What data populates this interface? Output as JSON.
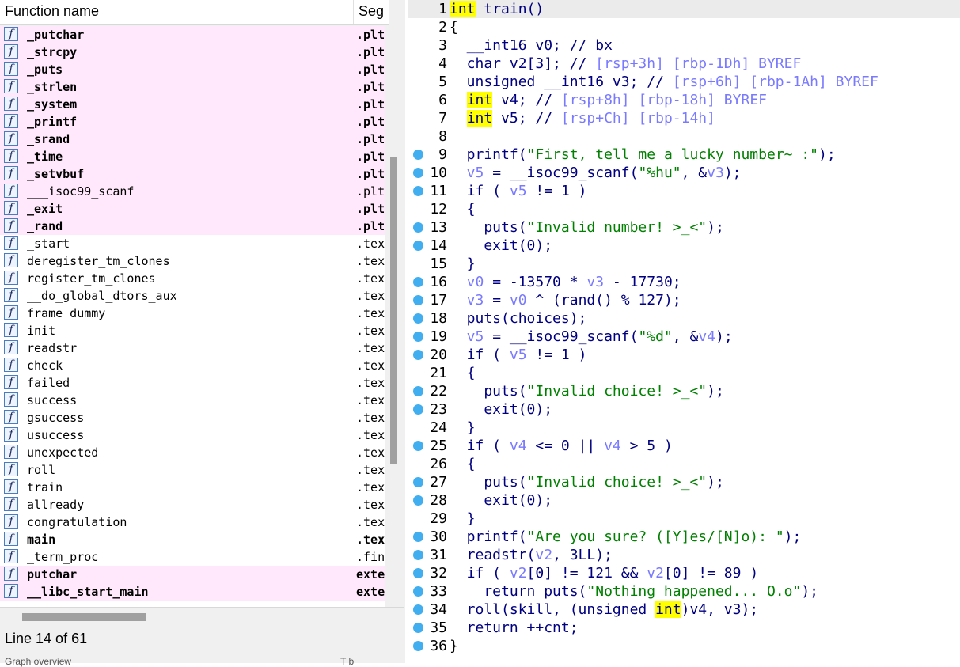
{
  "function_list": {
    "header": {
      "name_col": "Function name",
      "seg_col": "Seg"
    },
    "icon_glyph": "f",
    "rows": [
      {
        "name": "_putchar",
        "seg": ".plt",
        "bold": true,
        "pink": true
      },
      {
        "name": "_strcpy",
        "seg": ".plt",
        "bold": true,
        "pink": true
      },
      {
        "name": "_puts",
        "seg": ".plt",
        "bold": true,
        "pink": true
      },
      {
        "name": "_strlen",
        "seg": ".plt",
        "bold": true,
        "pink": true
      },
      {
        "name": "_system",
        "seg": ".plt",
        "bold": true,
        "pink": true
      },
      {
        "name": "_printf",
        "seg": ".plt",
        "bold": true,
        "pink": true
      },
      {
        "name": "_srand",
        "seg": ".plt",
        "bold": true,
        "pink": true
      },
      {
        "name": "_time",
        "seg": ".plt",
        "bold": true,
        "pink": true
      },
      {
        "name": "_setvbuf",
        "seg": ".plt",
        "bold": true,
        "pink": true
      },
      {
        "name": "___isoc99_scanf",
        "seg": ".plt",
        "bold": false,
        "pink": true
      },
      {
        "name": "_exit",
        "seg": ".plt",
        "bold": true,
        "pink": true
      },
      {
        "name": "_rand",
        "seg": ".plt",
        "bold": true,
        "pink": true
      },
      {
        "name": "_start",
        "seg": ".text",
        "bold": false,
        "pink": false
      },
      {
        "name": "deregister_tm_clones",
        "seg": ".text",
        "bold": false,
        "pink": false
      },
      {
        "name": "register_tm_clones",
        "seg": ".text",
        "bold": false,
        "pink": false
      },
      {
        "name": "__do_global_dtors_aux",
        "seg": ".text",
        "bold": false,
        "pink": false
      },
      {
        "name": "frame_dummy",
        "seg": ".text",
        "bold": false,
        "pink": false
      },
      {
        "name": "init",
        "seg": ".text",
        "bold": false,
        "pink": false
      },
      {
        "name": "readstr",
        "seg": ".text",
        "bold": false,
        "pink": false
      },
      {
        "name": "check",
        "seg": ".text",
        "bold": false,
        "pink": false
      },
      {
        "name": "failed",
        "seg": ".text",
        "bold": false,
        "pink": false
      },
      {
        "name": "success",
        "seg": ".text",
        "bold": false,
        "pink": false
      },
      {
        "name": "gsuccess",
        "seg": ".text",
        "bold": false,
        "pink": false
      },
      {
        "name": "usuccess",
        "seg": ".text",
        "bold": false,
        "pink": false
      },
      {
        "name": "unexpected",
        "seg": ".text",
        "bold": false,
        "pink": false
      },
      {
        "name": "roll",
        "seg": ".text",
        "bold": false,
        "pink": false
      },
      {
        "name": "train",
        "seg": ".text",
        "bold": false,
        "pink": false
      },
      {
        "name": "allready",
        "seg": ".text",
        "bold": false,
        "pink": false
      },
      {
        "name": "congratulation",
        "seg": ".text",
        "bold": false,
        "pink": false
      },
      {
        "name": "main",
        "seg": ".text",
        "bold": true,
        "pink": false
      },
      {
        "name": "_term_proc",
        "seg": ".fini",
        "bold": false,
        "pink": false
      },
      {
        "name": "putchar",
        "seg": "extern",
        "bold": true,
        "pink": true
      },
      {
        "name": "__libc_start_main",
        "seg": "extern",
        "bold": true,
        "pink": true
      }
    ],
    "status": "Line 14 of 61",
    "bottom_cut": "Graph overview",
    "bottom_cut_right": "T  b"
  },
  "pseudocode": {
    "bullet_color": "#41aef0",
    "lines": [
      {
        "n": "1",
        "dot": false,
        "hl": true,
        "parts": [
          [
            "kh",
            "int"
          ],
          [
            "k",
            " train()"
          ]
        ]
      },
      {
        "n": "2",
        "dot": false,
        "parts": [
          [
            "",
            "{"
          ]
        ]
      },
      {
        "n": "3",
        "dot": false,
        "parts": [
          [
            "c",
            "  __int16 v0; // bx"
          ]
        ]
      },
      {
        "n": "4",
        "dot": false,
        "parts": [
          [
            "c",
            "  char v2[3]; // "
          ],
          [
            "cc",
            "[rsp+3h] [rbp-1Dh] BYREF"
          ]
        ]
      },
      {
        "n": "5",
        "dot": false,
        "parts": [
          [
            "k",
            "  unsigned __int16 v3; // "
          ],
          [
            "cc",
            "[rsp+6h] [rbp-1Ah] BYREF"
          ]
        ]
      },
      {
        "n": "6",
        "dot": false,
        "parts": [
          [
            "",
            "  "
          ],
          [
            "kh",
            "int"
          ],
          [
            "k",
            " v4; // "
          ],
          [
            "cc",
            "[rsp+8h] [rbp-18h] BYREF"
          ]
        ]
      },
      {
        "n": "7",
        "dot": false,
        "parts": [
          [
            "",
            "  "
          ],
          [
            "kh",
            "int"
          ],
          [
            "k",
            " v5; // "
          ],
          [
            "cc",
            "[rsp+Ch] [rbp-14h]"
          ]
        ]
      },
      {
        "n": "8",
        "dot": false,
        "parts": [
          [
            "",
            ""
          ]
        ]
      },
      {
        "n": "9",
        "dot": true,
        "parts": [
          [
            "k",
            "  printf("
          ],
          [
            "s",
            "\"First, tell me a lucky number~ :\""
          ],
          [
            "k",
            ");"
          ]
        ]
      },
      {
        "n": "10",
        "dot": true,
        "parts": [
          [
            "v",
            "  v5"
          ],
          [
            "k",
            " = __isoc99_scanf("
          ],
          [
            "s",
            "\"%hu\""
          ],
          [
            "k",
            ", &"
          ],
          [
            "v",
            "v3"
          ],
          [
            "k",
            ");"
          ]
        ]
      },
      {
        "n": "11",
        "dot": true,
        "parts": [
          [
            "k",
            "  if ( "
          ],
          [
            "v",
            "v5"
          ],
          [
            "k",
            " != 1 )"
          ]
        ]
      },
      {
        "n": "12",
        "dot": false,
        "parts": [
          [
            "k",
            "  {"
          ]
        ]
      },
      {
        "n": "13",
        "dot": true,
        "parts": [
          [
            "k",
            "    puts("
          ],
          [
            "s",
            "\"Invalid number! >_<\""
          ],
          [
            "k",
            ");"
          ]
        ]
      },
      {
        "n": "14",
        "dot": true,
        "parts": [
          [
            "k",
            "    exit(0);"
          ]
        ]
      },
      {
        "n": "15",
        "dot": false,
        "parts": [
          [
            "k",
            "  }"
          ]
        ]
      },
      {
        "n": "16",
        "dot": true,
        "parts": [
          [
            "v",
            "  v0"
          ],
          [
            "k",
            " = -13570 * "
          ],
          [
            "v",
            "v3"
          ],
          [
            "k",
            " - 17730;"
          ]
        ]
      },
      {
        "n": "17",
        "dot": true,
        "parts": [
          [
            "v",
            "  v3"
          ],
          [
            "k",
            " = "
          ],
          [
            "v",
            "v0"
          ],
          [
            "k",
            " ^ (rand() % 127);"
          ]
        ]
      },
      {
        "n": "18",
        "dot": true,
        "parts": [
          [
            "k",
            "  puts(choices);"
          ]
        ]
      },
      {
        "n": "19",
        "dot": true,
        "parts": [
          [
            "v",
            "  v5"
          ],
          [
            "k",
            " = __isoc99_scanf("
          ],
          [
            "s",
            "\"%d\""
          ],
          [
            "k",
            ", &"
          ],
          [
            "v",
            "v4"
          ],
          [
            "k",
            ");"
          ]
        ]
      },
      {
        "n": "20",
        "dot": true,
        "parts": [
          [
            "k",
            "  if ( "
          ],
          [
            "v",
            "v5"
          ],
          [
            "k",
            " != 1 )"
          ]
        ]
      },
      {
        "n": "21",
        "dot": false,
        "parts": [
          [
            "k",
            "  {"
          ]
        ]
      },
      {
        "n": "22",
        "dot": true,
        "parts": [
          [
            "k",
            "    puts("
          ],
          [
            "s",
            "\"Invalid choice! >_<\""
          ],
          [
            "k",
            ");"
          ]
        ]
      },
      {
        "n": "23",
        "dot": true,
        "parts": [
          [
            "k",
            "    exit(0);"
          ]
        ]
      },
      {
        "n": "24",
        "dot": false,
        "parts": [
          [
            "k",
            "  }"
          ]
        ]
      },
      {
        "n": "25",
        "dot": true,
        "parts": [
          [
            "k",
            "  if ( "
          ],
          [
            "v",
            "v4"
          ],
          [
            "k",
            " <= 0 || "
          ],
          [
            "v",
            "v4"
          ],
          [
            "k",
            " > 5 )"
          ]
        ]
      },
      {
        "n": "26",
        "dot": false,
        "parts": [
          [
            "k",
            "  {"
          ]
        ]
      },
      {
        "n": "27",
        "dot": true,
        "parts": [
          [
            "k",
            "    puts("
          ],
          [
            "s",
            "\"Invalid choice! >_<\""
          ],
          [
            "k",
            ");"
          ]
        ]
      },
      {
        "n": "28",
        "dot": true,
        "parts": [
          [
            "k",
            "    exit(0);"
          ]
        ]
      },
      {
        "n": "29",
        "dot": false,
        "parts": [
          [
            "k",
            "  }"
          ]
        ]
      },
      {
        "n": "30",
        "dot": true,
        "parts": [
          [
            "k",
            "  printf("
          ],
          [
            "s",
            "\"Are you sure? ([Y]es/[N]o): \""
          ],
          [
            "k",
            ");"
          ]
        ]
      },
      {
        "n": "31",
        "dot": true,
        "parts": [
          [
            "k",
            "  readstr("
          ],
          [
            "v",
            "v2"
          ],
          [
            "k",
            ", 3LL);"
          ]
        ]
      },
      {
        "n": "32",
        "dot": true,
        "parts": [
          [
            "k",
            "  if ( "
          ],
          [
            "v",
            "v2"
          ],
          [
            "k",
            "[0] != 121 && "
          ],
          [
            "v",
            "v2"
          ],
          [
            "k",
            "[0] != 89 )"
          ]
        ]
      },
      {
        "n": "33",
        "dot": true,
        "parts": [
          [
            "k",
            "    return puts("
          ],
          [
            "s",
            "\"Nothing happened... O.o\""
          ],
          [
            "k",
            ");"
          ]
        ]
      },
      {
        "n": "34",
        "dot": true,
        "parts": [
          [
            "k",
            "  roll(skill, (unsigned "
          ],
          [
            "kh",
            "int"
          ],
          [
            "k",
            ")v4, v3);"
          ]
        ]
      },
      {
        "n": "35",
        "dot": true,
        "parts": [
          [
            "k",
            "  return ++cnt;"
          ]
        ]
      },
      {
        "n": "36",
        "dot": true,
        "parts": [
          [
            "",
            "}"
          ]
        ]
      }
    ]
  }
}
